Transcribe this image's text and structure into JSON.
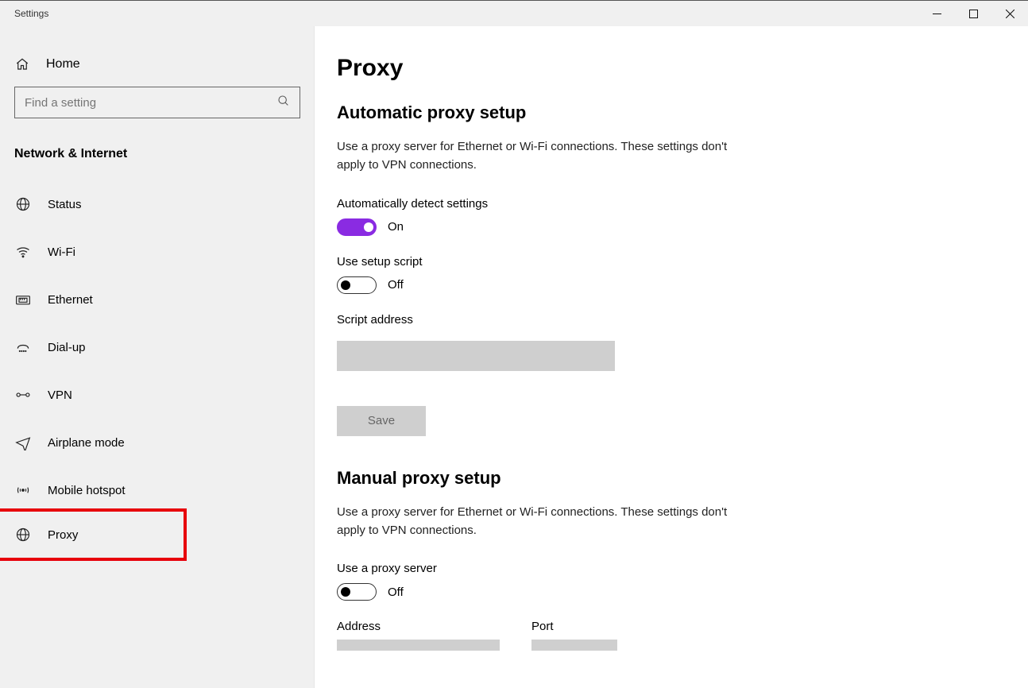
{
  "window": {
    "title": "Settings"
  },
  "sidebar": {
    "home": "Home",
    "search_placeholder": "Find a setting",
    "section": "Network & Internet",
    "items": [
      {
        "label": "Status"
      },
      {
        "label": "Wi-Fi"
      },
      {
        "label": "Ethernet"
      },
      {
        "label": "Dial-up"
      },
      {
        "label": "VPN"
      },
      {
        "label": "Airplane mode"
      },
      {
        "label": "Mobile hotspot"
      },
      {
        "label": "Proxy"
      }
    ]
  },
  "page": {
    "title": "Proxy",
    "auto": {
      "heading": "Automatic proxy setup",
      "desc": "Use a proxy server for Ethernet or Wi-Fi connections. These settings don't apply to VPN connections.",
      "detect_label": "Automatically detect settings",
      "detect_state": "On",
      "script_label": "Use setup script",
      "script_state": "Off",
      "script_addr_label": "Script address",
      "script_addr_value": "",
      "save_label": "Save"
    },
    "manual": {
      "heading": "Manual proxy setup",
      "desc": "Use a proxy server for Ethernet or Wi-Fi connections. These settings don't apply to VPN connections.",
      "use_label": "Use a proxy server",
      "use_state": "Off",
      "address_label": "Address",
      "port_label": "Port"
    }
  }
}
